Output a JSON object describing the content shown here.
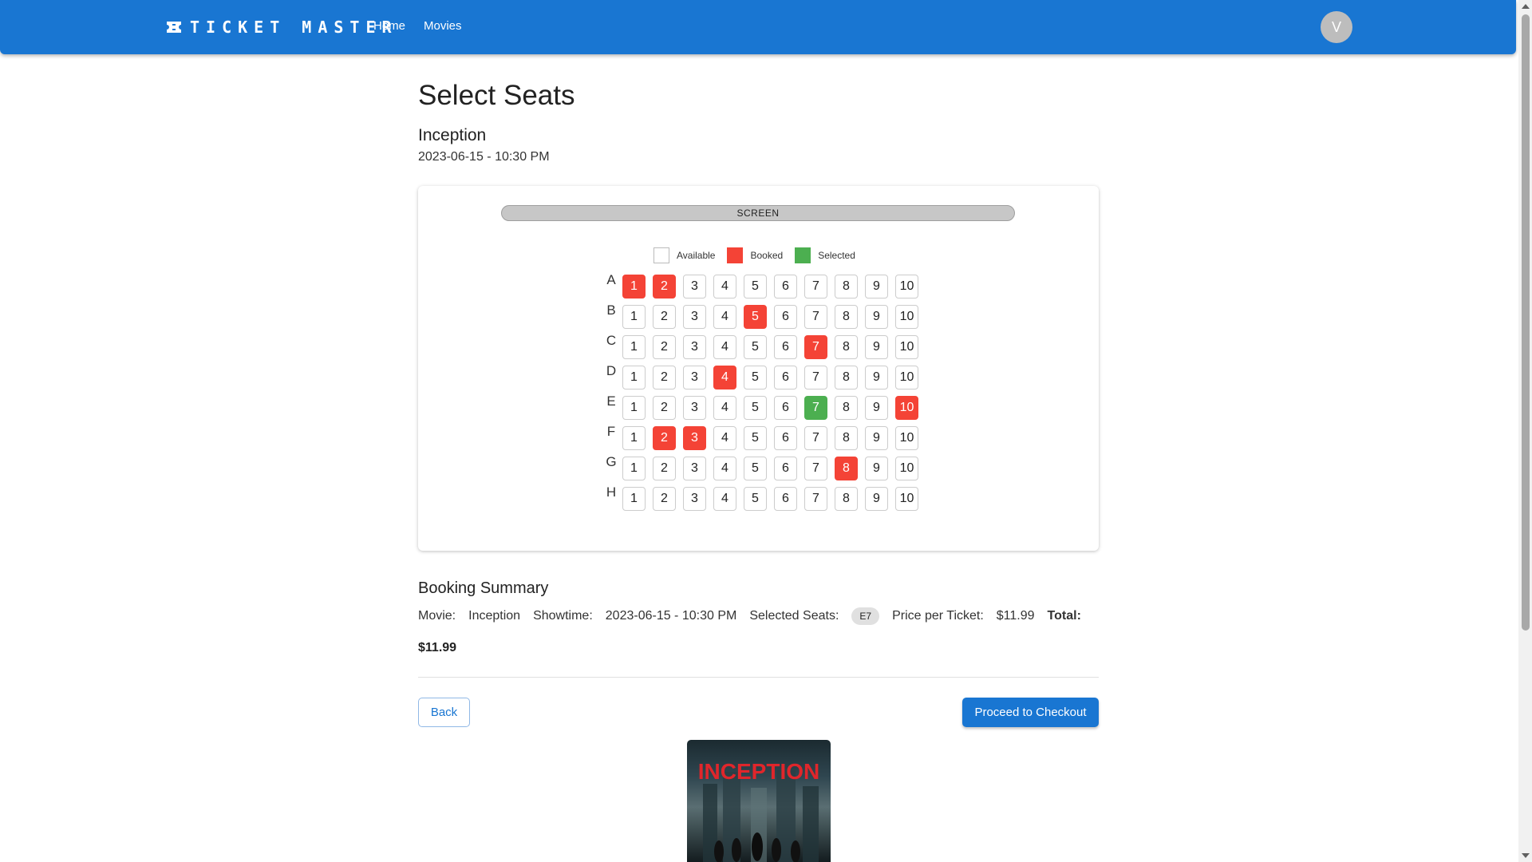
{
  "header": {
    "brand": "TICKET MASTER",
    "nav": [
      "Home",
      "Movies"
    ],
    "avatar_initial": "V"
  },
  "page": {
    "title": "Select Seats",
    "movie": "Inception",
    "showtime": "2023-06-15 - 10:30 PM"
  },
  "seat_map": {
    "screen_label": "SCREEN",
    "legend": {
      "available": "Available",
      "booked": "Booked",
      "selected": "Selected"
    },
    "rows": [
      "A",
      "B",
      "C",
      "D",
      "E",
      "F",
      "G",
      "H"
    ],
    "seats_per_row": 10,
    "booked": [
      "A1",
      "A2",
      "B5",
      "C7",
      "D4",
      "E10",
      "F2",
      "F3",
      "G8"
    ],
    "selected": [
      "E7"
    ]
  },
  "summary": {
    "title": "Booking Summary",
    "movie_label": "Movie:",
    "movie_value": "Inception",
    "showtime_label": "Showtime:",
    "showtime_value": "2023-06-15 - 10:30 PM",
    "seats_label": "Selected Seats:",
    "seats_chip": "E7",
    "price_label": "Price per Ticket:",
    "price_value": "$11.99",
    "total_label": "Total:",
    "total_value": "$11.99"
  },
  "actions": {
    "back": "Back",
    "checkout": "Proceed to Checkout"
  },
  "poster": {
    "title": "INCEPTION"
  },
  "colors": {
    "primary": "#1976d2",
    "booked": "#f44336",
    "selected": "#4caf50"
  }
}
